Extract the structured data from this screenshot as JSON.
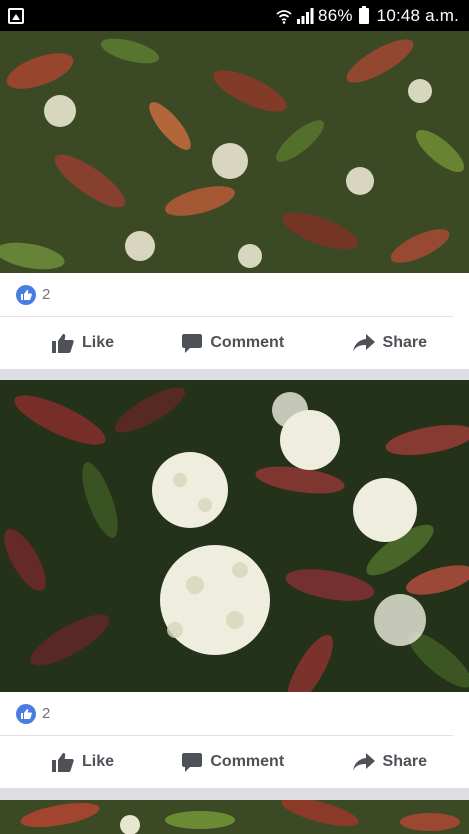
{
  "status_bar": {
    "battery_percent": "86%",
    "time": "10:48 a.m."
  },
  "posts": [
    {
      "reaction_count": "2",
      "like_label": "Like",
      "comment_label": "Comment",
      "share_label": "Share"
    },
    {
      "reaction_count": "2",
      "like_label": "Like",
      "comment_label": "Comment",
      "share_label": "Share"
    }
  ],
  "colors": {
    "like_blue": "#4a7de4",
    "action_text": "#4e5156",
    "feed_background": "#dcdee3"
  }
}
